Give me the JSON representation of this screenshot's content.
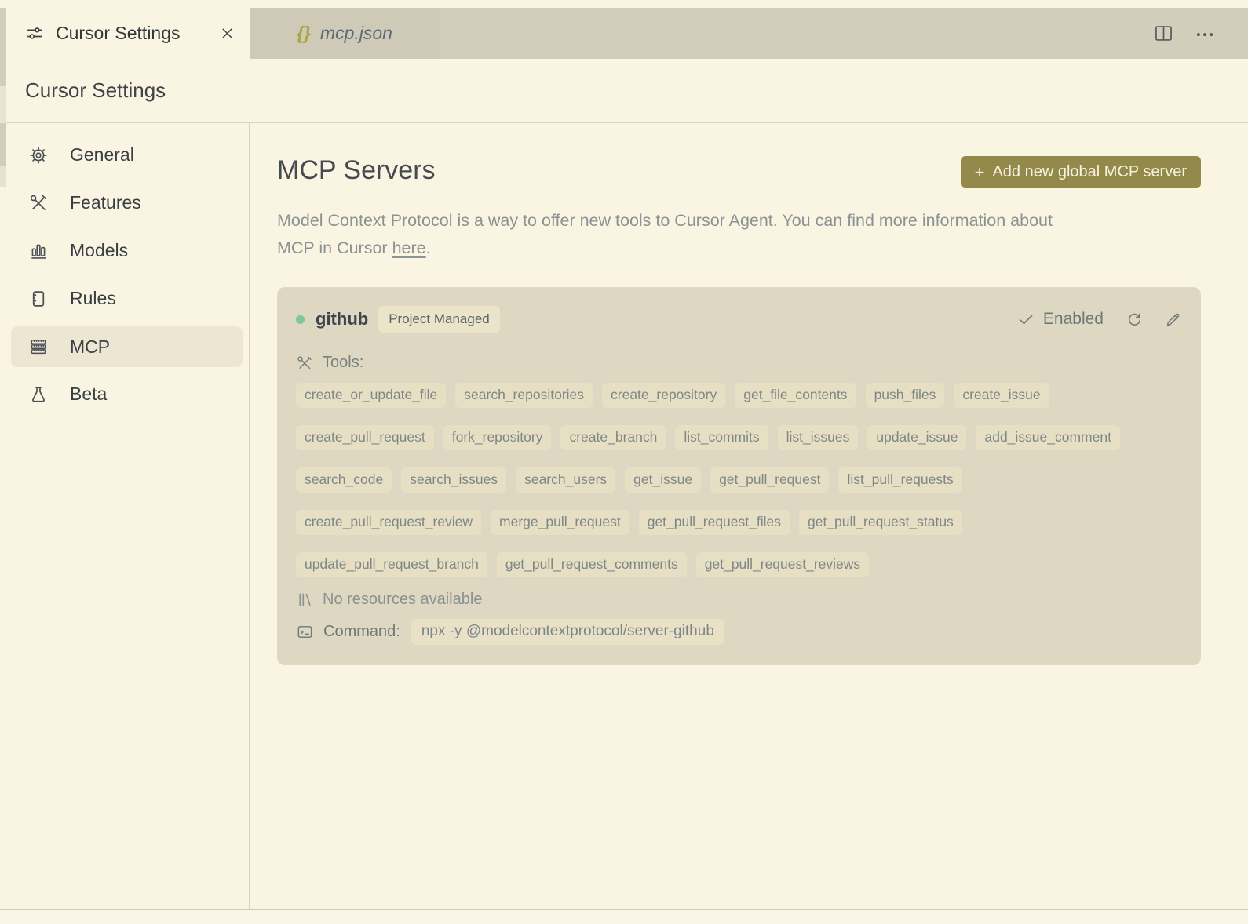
{
  "colors": {
    "background": "#faf4e2",
    "tab_strip": "#d3cdbc",
    "card": "#ded8c2",
    "accent_olive": "#93894a",
    "status_green": "#7dc79b",
    "sidebar_highlight": "#ece6d3"
  },
  "icons": {
    "braces": "{}",
    "plus": "+"
  },
  "tab_bar": {
    "tabs": [
      {
        "label": "Cursor Settings",
        "icon": "sliders-icon",
        "active": true
      },
      {
        "label": "mcp.json",
        "icon": "braces-icon",
        "active": false
      }
    ],
    "actions": [
      {
        "name": "split-editor"
      },
      {
        "name": "more-actions"
      }
    ]
  },
  "page_title": "Cursor Settings",
  "sidebar": {
    "active_item": "MCP",
    "items": [
      {
        "label": "General",
        "icon": "gear-icon"
      },
      {
        "label": "Features",
        "icon": "tools-icon"
      },
      {
        "label": "Models",
        "icon": "bar-chart-icon"
      },
      {
        "label": "Rules",
        "icon": "ruler-doc-icon"
      },
      {
        "label": "MCP",
        "icon": "server-stack-icon"
      },
      {
        "label": "Beta",
        "icon": "beaker-icon"
      }
    ]
  },
  "main": {
    "title": "MCP Servers",
    "add_button": {
      "plus": "+",
      "label": "Add new global MCP server"
    },
    "description": {
      "line1": "Model Context Protocol is a way to offer new tools to Cursor Agent. You can find more information about",
      "line2_before": "MCP in Cursor ",
      "link_text": "here",
      "line2_after": "."
    },
    "server": {
      "name": "github",
      "badge": "Project Managed",
      "status_label": "Enabled",
      "tools_label": "Tools:",
      "tools": [
        "create_or_update_file",
        "search_repositories",
        "create_repository",
        "get_file_contents",
        "push_files",
        "create_issue",
        "create_pull_request",
        "fork_repository",
        "create_branch",
        "list_commits",
        "list_issues",
        "update_issue",
        "add_issue_comment",
        "search_code",
        "search_issues",
        "search_users",
        "get_issue",
        "get_pull_request",
        "list_pull_requests",
        "create_pull_request_review",
        "merge_pull_request",
        "get_pull_request_files",
        "get_pull_request_status",
        "update_pull_request_branch",
        "get_pull_request_comments",
        "get_pull_request_reviews"
      ],
      "resources_label": "No resources available",
      "command_label": "Command:",
      "command_value": "npx -y @modelcontextprotocol/server-github"
    }
  }
}
